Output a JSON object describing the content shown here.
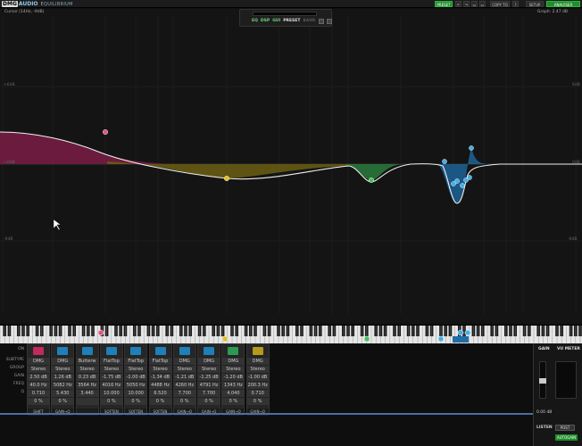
{
  "app": {
    "logo_box": "DMG",
    "logo_audio": "AUDIO",
    "product": "EQUILIBRIUM"
  },
  "top_buttons": {
    "preset": "PRESET",
    "copy": "COPY TO",
    "setup": "SETUP",
    "analyser": "ANALYSER"
  },
  "info": {
    "cursor": "Cursor (14Hz, -9dB)",
    "graph": "Graph: 2.47 dB"
  },
  "nav": [
    "EQ",
    "DSP",
    "GUI",
    "PRESET",
    "BANK"
  ],
  "db_labels": {
    "top_left": "+6dB",
    "mid_left": "+0dB",
    "low_left": "-6dB",
    "top_right": "6dB",
    "mid_right": "0dB",
    "low_right": "-6dB"
  },
  "freq_labels": [
    "10",
    "20",
    "40",
    "60",
    "80",
    "100",
    "200",
    "400",
    "600",
    "800",
    "1k",
    "2k",
    "4k",
    "6k",
    "8k",
    "10k",
    "20k"
  ],
  "row_labels": [
    "ON",
    "SUBTYPE",
    "GROUP",
    "GAIN",
    "FREQ",
    "Q",
    ""
  ],
  "bands": [
    {
      "type": "DMG",
      "group": "Stereo",
      "gain": "2.50 dB",
      "freq": "40.0 Hz",
      "q": "0.710",
      "extra": "0 %",
      "foot": "SHIFT",
      "color": "#c02a5e"
    },
    {
      "type": "DMG",
      "group": "Stereo",
      "gain": "1.26 dB",
      "freq": "5082 Hz",
      "q": "5.430",
      "extra": "0 %",
      "foot": "GAIN→Q",
      "color": "#1f7fb8"
    },
    {
      "type": "Butterw",
      "group": "Stereo",
      "gain": "0.23 dB",
      "freq": "3564 Hz",
      "q": "3.440",
      "extra": "",
      "foot": "",
      "color": "#1f7fb8"
    },
    {
      "type": "FlatTop",
      "group": "Stereo",
      "gain": "-1.75 dB",
      "freq": "4016 Hz",
      "q": "10.000",
      "extra": "0 %",
      "foot": "SOFTEN",
      "color": "#1f7fb8"
    },
    {
      "type": "FlatTop",
      "group": "Stereo",
      "gain": "-1.00 dB",
      "freq": "5050 Hz",
      "q": "10.000",
      "extra": "0 %",
      "foot": "SOFTEN",
      "color": "#1f7fb8"
    },
    {
      "type": "FlatTop",
      "group": "Stereo",
      "gain": "-1.34 dB",
      "freq": "4488 Hz",
      "q": "6.520",
      "extra": "0 %",
      "foot": "SOFTEN",
      "color": "#1f7fb8"
    },
    {
      "type": "DMG",
      "group": "Stereo",
      "gain": "-1.21 dB",
      "freq": "4260 Hz",
      "q": "7.700",
      "extra": "0 %",
      "foot": "GAIN→Q",
      "color": "#1f7fb8"
    },
    {
      "type": "DMG",
      "group": "Stereo",
      "gain": "-1.25 dB",
      "freq": "4791 Hz",
      "q": "7.700",
      "extra": "0 %",
      "foot": "GAIN→Q",
      "color": "#1f7fb8"
    },
    {
      "type": "DMG",
      "group": "Stereo",
      "gain": "-1.20 dB",
      "freq": "1343 Hz",
      "q": "4.040",
      "extra": "0 %",
      "foot": "GAIN→Q",
      "color": "#2a9a55"
    },
    {
      "type": "DMG",
      "group": "Stereo",
      "gain": "-1.00 dB",
      "freq": "200.3 Hz",
      "q": "0.710",
      "extra": "0 %",
      "foot": "GAIN→Q",
      "color": "#b59a1c"
    }
  ],
  "meter": {
    "gain_title": "GAIN",
    "vu_title": "VU METER",
    "gain_value": "0.00 dB",
    "listen_label": "LISTEN",
    "post_label": "POST",
    "autogain_label": "AUTOGAIN"
  }
}
